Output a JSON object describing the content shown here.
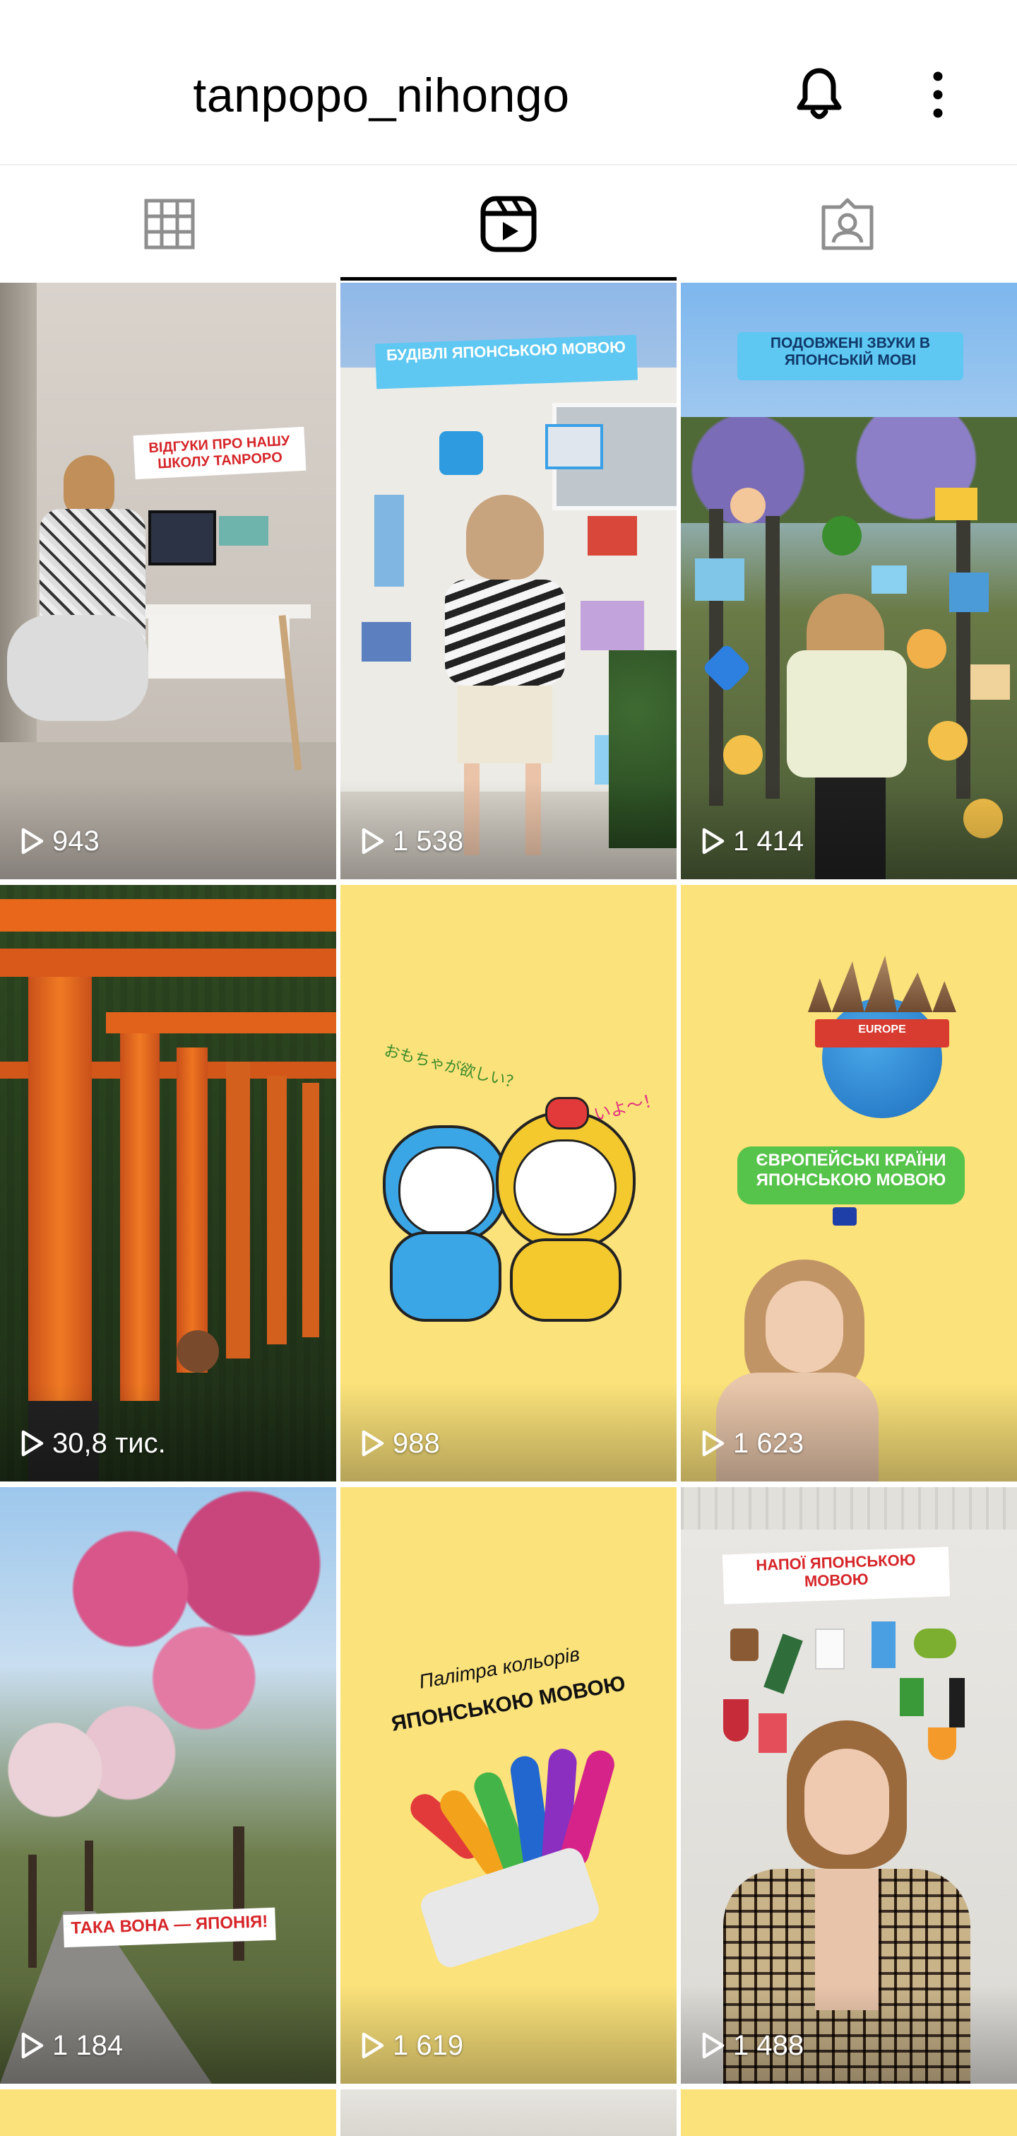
{
  "header": {
    "username": "tanpopo_nihongo",
    "bell_icon": "bell-icon",
    "more_icon": "more-vertical-icon"
  },
  "tabs": [
    {
      "icon": "grid-icon",
      "selected": false
    },
    {
      "icon": "reels-icon",
      "selected": true
    },
    {
      "icon": "tagged-user-icon",
      "selected": false
    }
  ],
  "reels": [
    {
      "views": "943",
      "caption": "ВІДГУКИ ПРО НАШУ ШКОЛУ TANPOPO"
    },
    {
      "views": "1 538",
      "caption": "БУДІВЛІ ЯПОНСЬКОЮ МОВОЮ"
    },
    {
      "views": "1 414",
      "caption": "ПОДОВЖЕНІ ЗВУКИ В ЯПОНСЬКІЙ МОВІ"
    },
    {
      "views": "30,8 тис.",
      "caption": ""
    },
    {
      "views": "988",
      "caption": "おもちゃが欲しい？",
      "caption2": "欲しいよ〜！"
    },
    {
      "views": "1 623",
      "caption": "ЄВРОПЕЙСЬКІ КРАЇНИ ЯПОНСЬКОЮ МОВОЮ",
      "caption2": "EUROPE"
    },
    {
      "views": "1 184",
      "caption": "ТАКА ВОНА — ЯПОНІЯ!"
    },
    {
      "views": "1 619",
      "caption": "Палітра кольорів",
      "caption2": "ЯПОНСЬКОЮ МОВОЮ"
    },
    {
      "views": "1 488",
      "caption": "НАПОЇ ЯПОНСЬКОЮ МОВОЮ"
    }
  ],
  "colors": {
    "accent": "#000000",
    "yellow_tile": "#fbe27a",
    "torii_orange": "#e2621b",
    "sky_blue": "#8fc3ec"
  }
}
